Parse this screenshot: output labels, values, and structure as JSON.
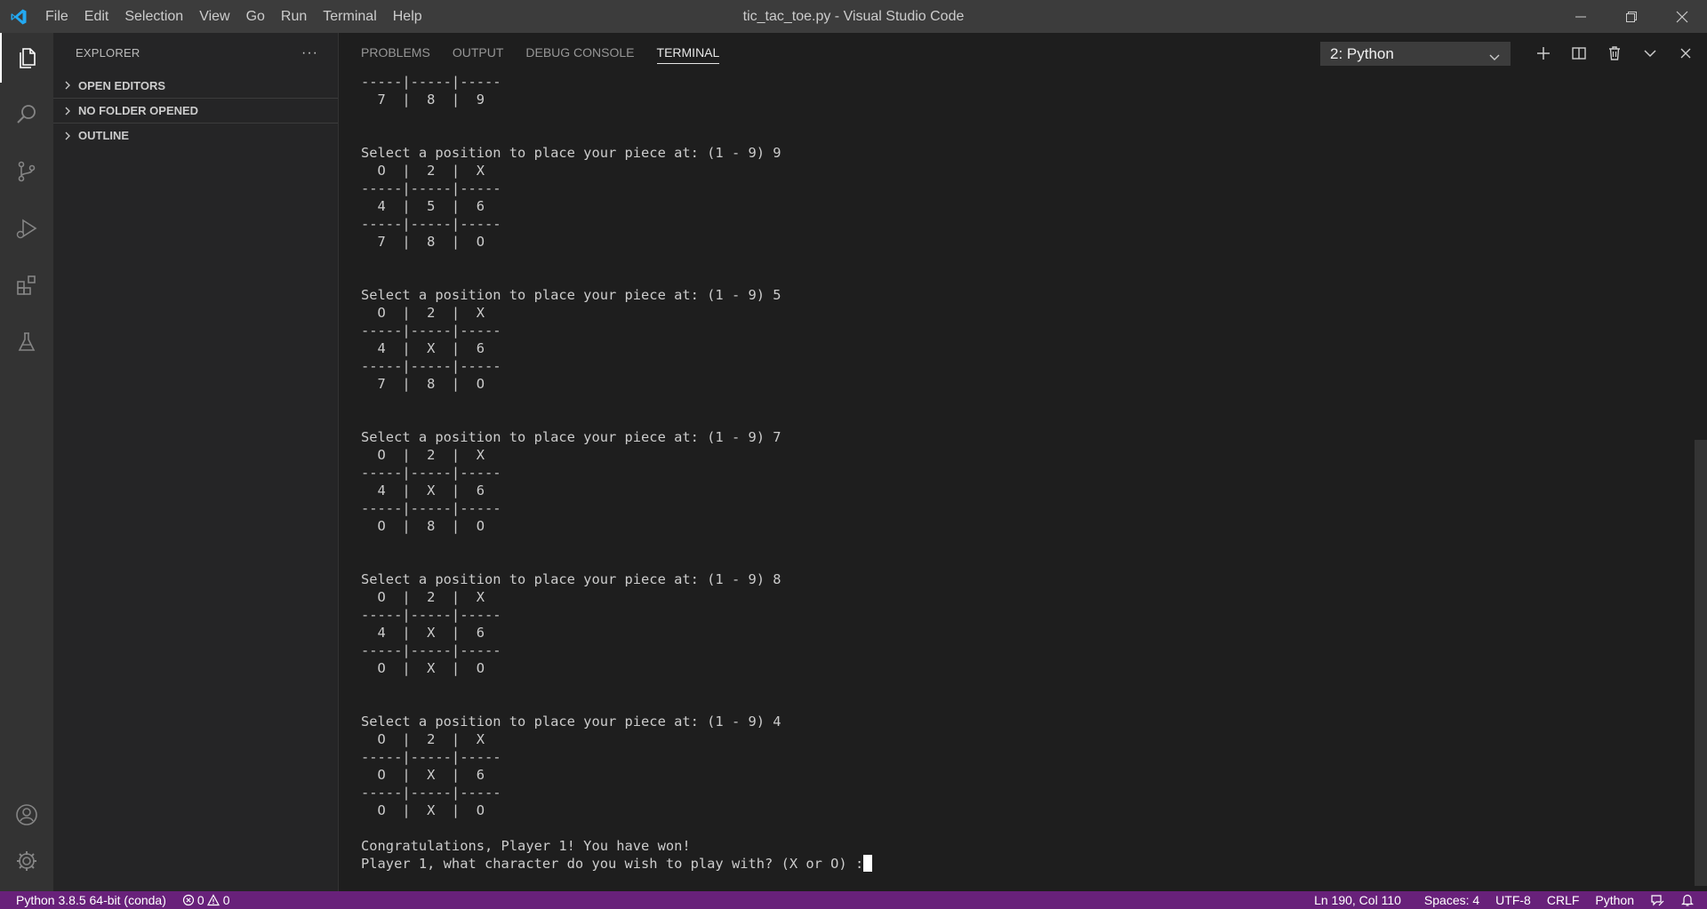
{
  "window": {
    "title": "tic_tac_toe.py - Visual Studio Code",
    "menu": [
      "File",
      "Edit",
      "Selection",
      "View",
      "Go",
      "Run",
      "Terminal",
      "Help"
    ]
  },
  "activity_bar": {
    "items": [
      "explorer-icon",
      "search-icon",
      "source-control-icon",
      "run-debug-icon",
      "extensions-icon",
      "testing-icon"
    ],
    "bottom": [
      "account-icon",
      "manage-gear-icon"
    ]
  },
  "sidebar": {
    "title": "EXPLORER",
    "more": "···",
    "sections": [
      "OPEN EDITORS",
      "NO FOLDER OPENED",
      "OUTLINE"
    ]
  },
  "panel": {
    "tabs": [
      "PROBLEMS",
      "OUTPUT",
      "DEBUG CONSOLE",
      "TERMINAL"
    ],
    "active_tab": "TERMINAL",
    "terminal_select": "2: Python"
  },
  "terminal": {
    "lines": [
      "-----|-----|-----",
      "  7  |  8  |  9",
      "",
      "",
      "Select a position to place your piece at: (1 - 9) 9",
      "  O  |  2  |  X",
      "-----|-----|-----",
      "  4  |  5  |  6",
      "-----|-----|-----",
      "  7  |  8  |  O",
      "",
      "",
      "Select a position to place your piece at: (1 - 9) 5",
      "  O  |  2  |  X",
      "-----|-----|-----",
      "  4  |  X  |  6",
      "-----|-----|-----",
      "  7  |  8  |  O",
      "",
      "",
      "Select a position to place your piece at: (1 - 9) 7",
      "  O  |  2  |  X",
      "-----|-----|-----",
      "  4  |  X  |  6",
      "-----|-----|-----",
      "  O  |  8  |  O",
      "",
      "",
      "Select a position to place your piece at: (1 - 9) 8",
      "  O  |  2  |  X",
      "-----|-----|-----",
      "  4  |  X  |  6",
      "-----|-----|-----",
      "  O  |  X  |  O",
      "",
      "",
      "Select a position to place your piece at: (1 - 9) 4",
      "  O  |  2  |  X",
      "-----|-----|-----",
      "  O  |  X  |  6",
      "-----|-----|-----",
      "  O  |  X  |  O",
      "",
      "Congratulations, Player 1! You have won!"
    ],
    "prompt": "Player 1, what character do you wish to play with? (X or O) :"
  },
  "statusbar": {
    "interpreter": "Python 3.8.5 64-bit (conda)",
    "errors": "0",
    "warnings": "0",
    "position": "Ln 190, Col 110",
    "spaces": "Spaces: 4",
    "encoding": "UTF-8",
    "eol": "CRLF",
    "language": "Python",
    "bg_color": "#68217a"
  }
}
